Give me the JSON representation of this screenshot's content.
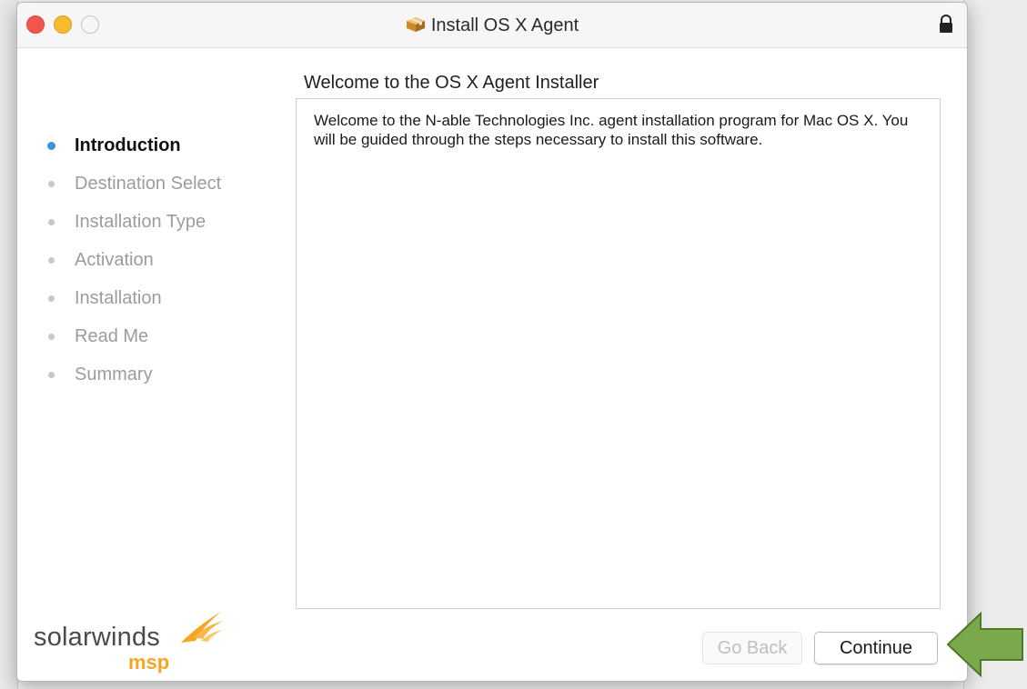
{
  "window": {
    "title": "Install OS X Agent"
  },
  "main": {
    "heading": "Welcome to the OS X Agent Installer",
    "body_text": "Welcome to the N-able Technologies Inc. agent installation program for Mac OS X. You will be guided through the steps necessary to install this software."
  },
  "sidebar": {
    "steps": [
      {
        "label": "Introduction",
        "active": true
      },
      {
        "label": "Destination Select",
        "active": false
      },
      {
        "label": "Installation Type",
        "active": false
      },
      {
        "label": "Activation",
        "active": false
      },
      {
        "label": "Installation",
        "active": false
      },
      {
        "label": "Read Me",
        "active": false
      },
      {
        "label": "Summary",
        "active": false
      }
    ]
  },
  "logo": {
    "word": "solarwinds",
    "sub": "msp"
  },
  "buttons": {
    "back_label": "Go Back",
    "continue_label": "Continue"
  },
  "colors": {
    "active_step_dot": "#3e92d8",
    "arrow": "#7aa84a",
    "logo_accent": "#f5a623"
  }
}
